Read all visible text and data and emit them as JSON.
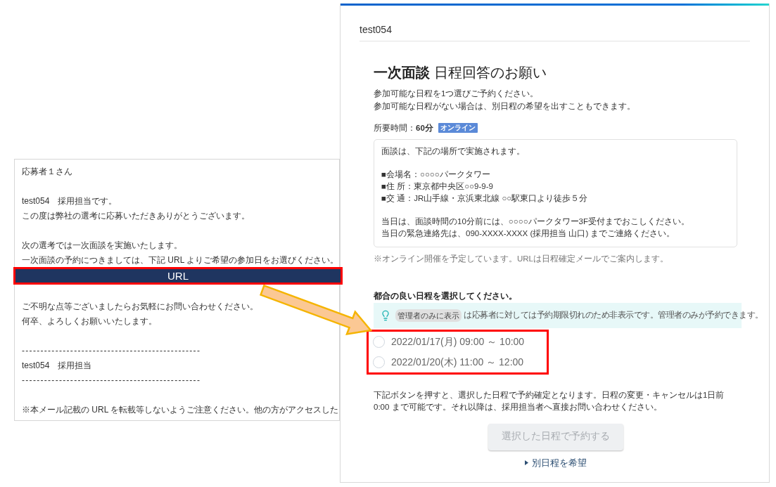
{
  "email": {
    "paragraphs": [
      {
        "lines": [
          {
            "kind": "text",
            "text": "応募者１さん"
          }
        ]
      },
      {
        "lines": [
          {
            "kind": "text",
            "text": "test054　採用担当です。"
          },
          {
            "kind": "text",
            "text": "この度は弊社の選考に応募いただきありがとうございます。"
          }
        ]
      },
      {
        "lines": [
          {
            "kind": "text",
            "text": "次の選考では一次面談を実施いたします。"
          },
          {
            "kind": "text",
            "text": "一次面談の予約につきましては、下記 URL よりご希望の参加日をお選びください。"
          },
          {
            "kind": "url_bar",
            "text": "URL",
            "highlighted": true
          }
        ]
      },
      {
        "lines": [
          {
            "kind": "text",
            "text": "ご不明な点等ございましたらお気軽にお問い合わせください。"
          },
          {
            "kind": "text",
            "text": "何卒、よろしくお願いいたします。"
          }
        ]
      },
      {
        "lines": [
          {
            "kind": "dashes",
            "text": "------------------------------------------------"
          },
          {
            "kind": "text",
            "text": "test054　採用担当"
          },
          {
            "kind": "dashes",
            "text": "------------------------------------------------"
          }
        ]
      },
      {
        "lines": [
          {
            "kind": "text",
            "text": "※本メール記載の URL を転載等しないようご注意ください。他の方がアクセスした"
          }
        ]
      }
    ]
  },
  "booking_page": {
    "company": "test054",
    "title": "**一次面談** 日程回答のお願い",
    "intro_lines": [
      "参加可能な日程を1つ選びご予約ください。",
      "参加可能な日程がない場合は、別日程の希望を出すこともできます。"
    ],
    "duration": {
      "text": "所要時間：**60分**",
      "badge": "オンライン"
    },
    "details": [
      [
        "面談は、下記の場所で実施されます。"
      ],
      [
        "■会場名：○○○○パークタワー",
        "■住 所：東京都中央区○○9-9-9",
        "■交 通：JR山手線・京浜東北線 ○○駅東口より徒歩５分"
      ],
      [
        "当日は、面談時間の10分前には、○○○○パークタワー3F受付までおこしください。",
        "当日の緊急連絡先は、090-XXXX-XXXX (採用担当 山口) までご連絡ください。"
      ]
    ],
    "note": "※オンライン開催を予定しています。URLは日程確定メールでご案内します。",
    "slot_heading": "都合の良い日程を選択してください。",
    "admin_notice": {
      "chip": "管理者のみに表示",
      "text": "は応募者に対しては予約期限切れのため非表示です。管理者のみが予約できます。"
    },
    "slots": {
      "highlighted": true,
      "options": [
        {
          "label": "2022/01/17(月) 09:00 ～ 10:00",
          "selected": false
        },
        {
          "label": "2022/01/20(木) 11:00 ～ 12:00",
          "selected": false
        }
      ]
    },
    "confirm_note": "下記ボタンを押すと、選択した日程で予約確定となります。日程の変更・キャンセルは1日前 0:00 まで可能です。それ以降は、採用担当者へ直接お問い合わせください。",
    "submit_button": {
      "label": "選択した日程で予約する",
      "disabled": true
    },
    "alternate_link": "別日程を希望"
  }
}
